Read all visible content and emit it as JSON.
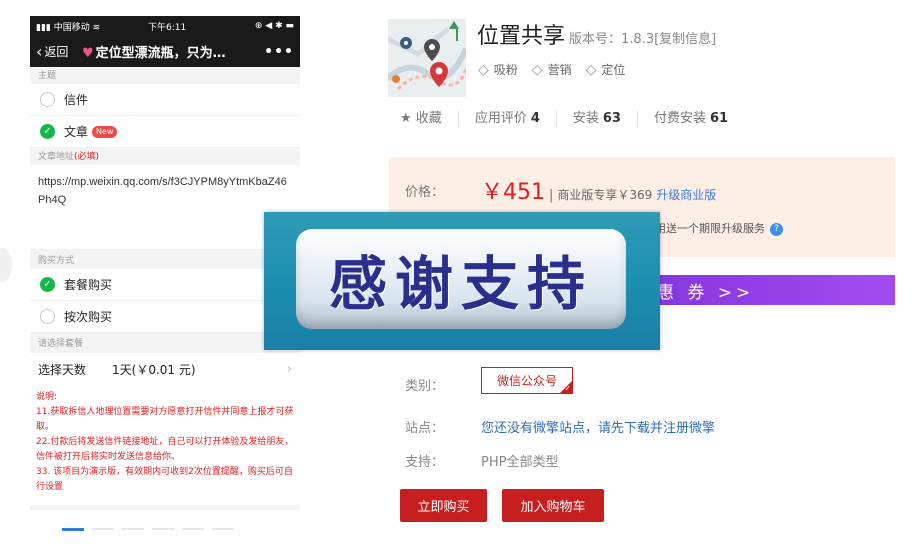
{
  "phone": {
    "status_left": "中国移动",
    "status_time": "下午6:11",
    "status_right": "⊕ ◀ ✱",
    "nav_back": "返回",
    "nav_title": "定位型漂流瓶，只为…",
    "nav_more": "•••",
    "section_theme": "主题",
    "opt_letter": "信件",
    "opt_article": "文章",
    "new_badge": "New",
    "section_url": "文章地址",
    "section_url_req": "(必填)",
    "url_value": "https://mp.weixin.qq.com/s/f3CJYPM8yYtmKbaZ46Ph4Q",
    "section_buy": "购买方式",
    "opt_package": "套餐购买",
    "opt_per": "按次购买",
    "section_plan": "请选择套餐",
    "select_days_label": "选择天数",
    "select_days_value": "1天(￥0.01 元)",
    "note_title": "说明:",
    "note_lines": [
      "11.获取拆信人地理位置需要对方愿意打开信件并同意上报才可获取。",
      "22.付款后将发送信件链接地址，自己可以打开体验及发给朋友，信件被打开后将实时发送信息给你。",
      "33. 该项目为演示版，有效期内可收到2次位置提醒，购买后可自行设置"
    ]
  },
  "product": {
    "title": "位置共享",
    "version": "版本号：1.8.3[复制信息]",
    "tags": [
      "吸粉",
      "营销",
      "定位"
    ],
    "favorite": "收藏",
    "rating_label": "应用评价",
    "rating_value": "4",
    "install_label": "安装",
    "install_value": "63",
    "paid_install_label": "付费安装",
    "paid_install_value": "61",
    "price_label": "价格：",
    "price_value": "￥451",
    "price_sep": "|",
    "price_business": "商业版专享￥369",
    "price_upgrade": "升级商业版",
    "price_gift": "用送一个期限升级服务",
    "coupon_text": "惠 券 >>",
    "overlay_text": "感谢支持",
    "category_label": "类别：",
    "category_value": "微信公众号",
    "site_label": "站点：",
    "site_value": "您还没有微擎站点，请先下载并注册微擎",
    "support_label": "支持：",
    "support_value": "PHP全部类型",
    "buy_button": "立即购买",
    "cart_button": "加入购物车"
  },
  "colors": {
    "accent_red": "#c71f1f",
    "price_red": "#e02020",
    "link_blue": "#2f6db5",
    "check_green": "#14b84a",
    "coupon_purple": "#7d31d8"
  }
}
